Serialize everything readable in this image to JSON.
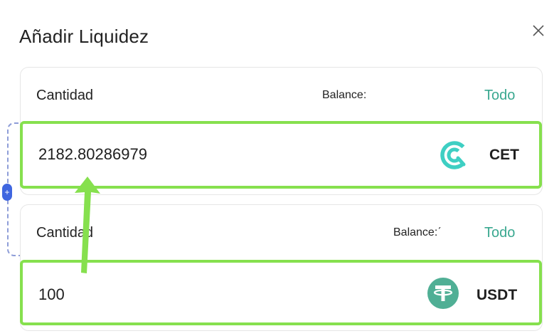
{
  "dialog": {
    "title": "Añadir Liquidez",
    "close_icon": "close-icon"
  },
  "link_toggle": {
    "label": "+",
    "icon": "link-plus-icon",
    "color": "#3f66e0"
  },
  "first_token": {
    "amount_label": "Cantidad",
    "balance_label": "Balance:",
    "max_label": "Todo",
    "amount_value": "2182.80286979",
    "symbol": "CET",
    "icon": "cet-coin-icon",
    "icon_color": "#3ecfc3"
  },
  "second_token": {
    "amount_label": "Cantidad",
    "balance_label": "Balance:ˊ",
    "max_label": "Todo",
    "amount_value": "100",
    "symbol": "USDT",
    "icon": "usdt-tether-icon",
    "icon_color": "#50af95"
  },
  "colors": {
    "accent": "#3aa890",
    "highlight": "#86e04e"
  },
  "annotation": {
    "icon": "arrow-up-annotation-icon"
  }
}
